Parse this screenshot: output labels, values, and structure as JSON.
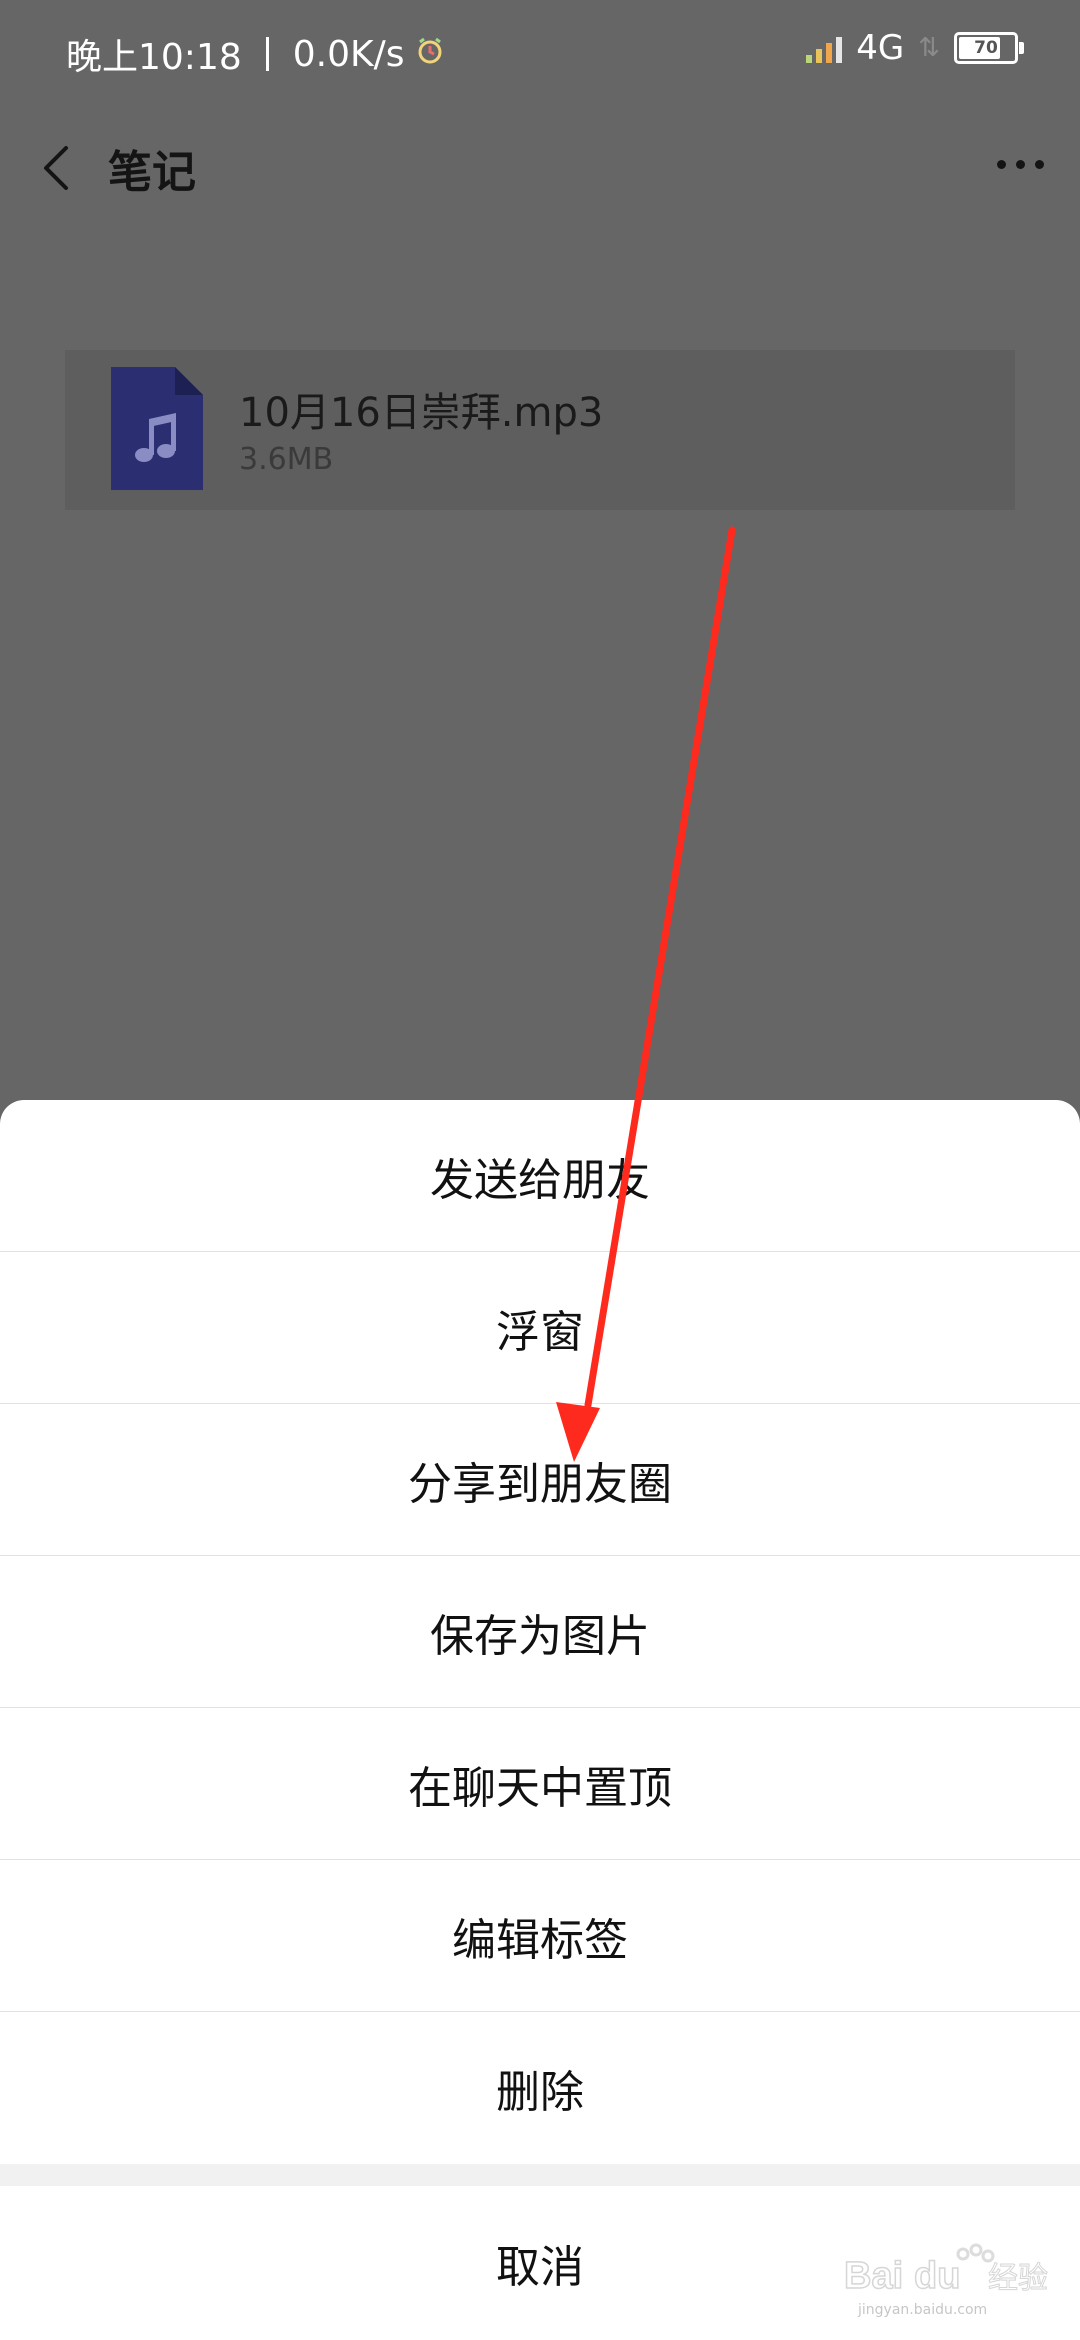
{
  "status_bar": {
    "time": "晚上10:18",
    "net_speed": "0.0K/s",
    "alarm_icon": "alarm-clock-icon",
    "network": "4G",
    "battery": 70
  },
  "header": {
    "title": "笔记",
    "back_icon": "chevron-left-icon",
    "more_icon": "more-dots-icon"
  },
  "file": {
    "name": "10月16日崇拜.mp3",
    "size": "3.6MB",
    "icon": "music-file-icon",
    "icon_color": "#2b2f72"
  },
  "sheet": {
    "options": [
      "发送给朋友",
      "浮窗",
      "分享到朋友圈",
      "保存为图片",
      "在聊天中置顶",
      "编辑标签",
      "删除"
    ],
    "cancel": "取消"
  },
  "annotation": {
    "color": "#ff2a1e"
  },
  "watermark": {
    "text": "Baidu经验",
    "sub": "jingyan.baidu.com"
  }
}
